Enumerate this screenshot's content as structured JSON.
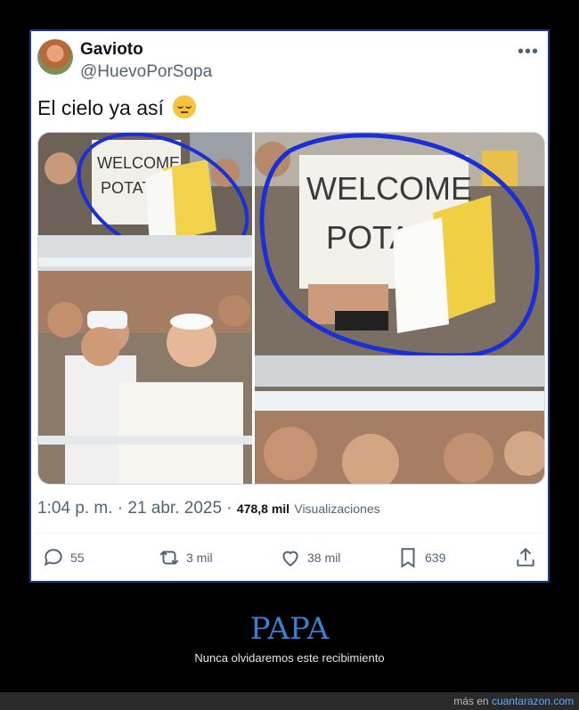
{
  "tweet": {
    "author_name": "Gavioto",
    "author_handle": "@HuevoPorSopa",
    "text": "El cielo ya así",
    "emoji": "pensive-face",
    "time": "1:04 p. m. · 21 abr. 2025 ·",
    "views_count": "478,8 mil",
    "views_label": "Visualizaciones",
    "more_label": "•••",
    "sign_text": [
      "WELCOME",
      "POTATO"
    ]
  },
  "actions": {
    "replies": "55",
    "retweets": "3 mil",
    "likes": "38 mil",
    "bookmarks": "639"
  },
  "footer": {
    "title": "PAPA",
    "subtitle": "Nunca olvidaremos este recibimiento",
    "more_on_prefix": "más en ",
    "site": "cuantarazon.com"
  },
  "colors": {
    "frame_border": "#1e3a8a",
    "circle_annotation": "#1a2fd6",
    "footer_title": "#3a7fd0",
    "site_link": "#5fa8ff"
  }
}
